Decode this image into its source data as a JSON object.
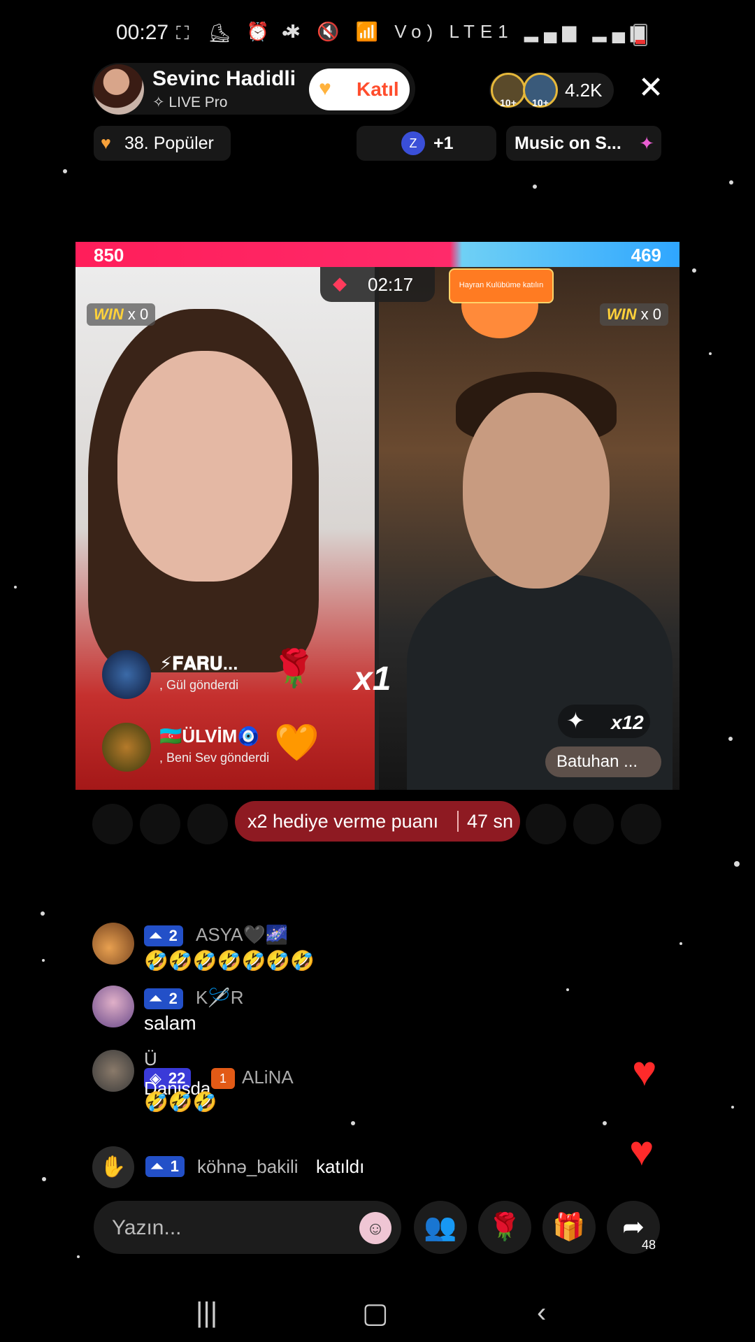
{
  "status_bar": {
    "time": "00:27",
    "left_icons": "⛶ ⛸ ⛶ •",
    "right_icons": "⏰ ✱ 🔇 📶 Vo) LTE1 ▂▄▆ ▂▄▆"
  },
  "host": {
    "name": "Sevinc Hadidli",
    "subtitle": "✧ LIVE Pro",
    "join_label": "Katıl",
    "viewer_badge_1": "10+",
    "viewer_badge_2": "10+",
    "viewer_count": "4.2K",
    "close_icon": "✕"
  },
  "pills": {
    "popular": "38. Popüler",
    "contrib_avatar": "Z",
    "contrib_plus": "+1",
    "music": "Music on S..."
  },
  "battle": {
    "score_left": "850",
    "score_right": "469",
    "win_left_label": "WIN",
    "win_left_count": "x 0",
    "win_right_label": "WIN",
    "win_right_count": "x 0",
    "timer": "02:17",
    "fan_club": "Hayran Kulübüme katılın",
    "gifts": [
      {
        "name": "⚡𝐅𝐀𝐑𝐔...",
        "message": ", Gül  gönderdi",
        "icon": "🌹"
      },
      {
        "name": "🇦🇿ÜLVİM🧿",
        "message": ", Beni Sev  gönderdi",
        "icon": "🧡"
      }
    ],
    "combo_left": "x1",
    "combo_right_count": "x12",
    "right_host_label": "Batuhan ..."
  },
  "multiplier": {
    "label": "x2 hediye verme puanı",
    "time": "47 sn"
  },
  "chat": [
    {
      "level": "2",
      "user": "ASYA🖤🌌",
      "text": "🤣🤣🤣🤣🤣🤣🤣"
    },
    {
      "level": "2",
      "user": "K🪡R",
      "text": "salam"
    },
    {
      "level": "22",
      "fan_level": "1",
      "user": "ALiNA",
      "overlay_user": "Ü",
      "overlay_text": "Danisda",
      "text": "🤣🤣🤣"
    }
  ],
  "joined": {
    "level": "1",
    "user": "köhnə_bakili",
    "action": "katıldı"
  },
  "bottom": {
    "input_placeholder": "Yazın...",
    "share_count": "48"
  },
  "colors": {
    "score_left": "#ff1e5a",
    "score_right": "#2fa6ff",
    "level_badge": "#2350c8",
    "multiplier_bg": "#8e1a22",
    "heart": "#ff2a2a"
  }
}
